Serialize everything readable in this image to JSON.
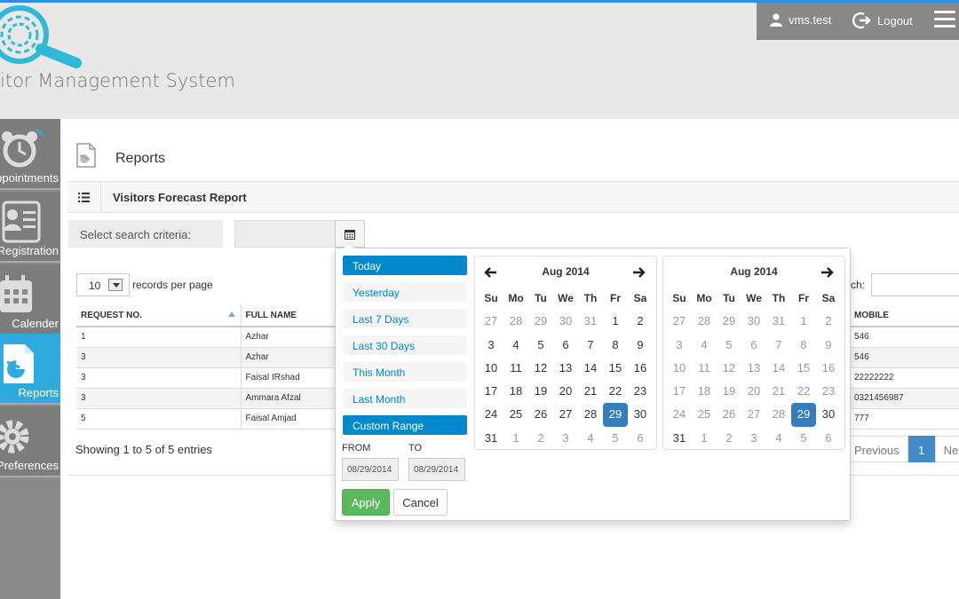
{
  "app": {
    "logo_text": "itor Management System",
    "user_name": "vms.test",
    "logout_label": "Logout"
  },
  "sidebar": {
    "items": [
      {
        "label": "Appointments",
        "icon": "alarm-clock-icon"
      },
      {
        "label": "Registration",
        "icon": "id-card-icon"
      },
      {
        "label": "Calender",
        "icon": "calendar-icon"
      },
      {
        "label": "Reports",
        "icon": "report-icon",
        "active": true
      },
      {
        "label": "Preferences",
        "icon": "gear-icon"
      }
    ]
  },
  "page": {
    "title": "Reports",
    "panel_title": "Visitors Forecast Report",
    "criteria_label": "Select search criteria:",
    "length_value": "10",
    "records_per_page": "records per page",
    "search_label": "rch:",
    "showing": "Showing 1 to 5 of 5 entries",
    "pager": {
      "previous": "Previous",
      "current": "1",
      "next": "Next"
    }
  },
  "table": {
    "headers": [
      "REQUEST NO.",
      "FULL NAME"
    ],
    "mobile_header": "MOBILE",
    "rows": [
      {
        "req": "1",
        "name": "Azhar",
        "mobile": "546"
      },
      {
        "req": "3",
        "name": "Azhar",
        "mobile": "546"
      },
      {
        "req": "3",
        "name": "Faisal IRshad",
        "mobile": "22222222"
      },
      {
        "req": "3",
        "name": "Ammara Afzal",
        "mobile": "0321456987"
      },
      {
        "req": "5",
        "name": "Faisal Amjad",
        "mobile": "777"
      }
    ]
  },
  "daterange": {
    "ranges": [
      {
        "label": "Today",
        "active": true
      },
      {
        "label": "Yesterday",
        "active": false
      },
      {
        "label": "Last 7 Days",
        "active": false
      },
      {
        "label": "Last 30 Days",
        "active": false
      },
      {
        "label": "This Month",
        "active": false
      },
      {
        "label": "Last Month",
        "active": false
      },
      {
        "label": "Custom Range",
        "active": true
      }
    ],
    "from_label": "FROM",
    "to_label": "TO",
    "from_value": "08/29/2014",
    "to_value": "08/29/2014",
    "apply_label": "Apply",
    "cancel_label": "Cancel",
    "weekdays": [
      "Su",
      "Mo",
      "Tu",
      "We",
      "Th",
      "Fr",
      "Sa"
    ],
    "calendars": [
      {
        "title": "Aug 2014",
        "selected": 29,
        "weeks": [
          [
            27,
            28,
            29,
            30,
            31,
            1,
            2
          ],
          [
            3,
            4,
            5,
            6,
            7,
            8,
            9
          ],
          [
            10,
            11,
            12,
            13,
            14,
            15,
            16
          ],
          [
            17,
            18,
            19,
            20,
            21,
            22,
            23
          ],
          [
            24,
            25,
            26,
            27,
            28,
            29,
            30
          ],
          [
            31,
            1,
            2,
            3,
            4,
            5,
            6
          ]
        ],
        "off": [
          [
            0,
            0
          ],
          [
            0,
            1
          ],
          [
            0,
            2
          ],
          [
            0,
            3
          ],
          [
            0,
            4
          ],
          [
            5,
            1
          ],
          [
            5,
            2
          ],
          [
            5,
            3
          ],
          [
            5,
            4
          ],
          [
            5,
            5
          ],
          [
            5,
            6
          ]
        ]
      },
      {
        "title": "Aug 2014",
        "selected": 29,
        "weeks": [
          [
            27,
            28,
            29,
            30,
            31,
            1,
            2
          ],
          [
            3,
            4,
            5,
            6,
            7,
            8,
            9
          ],
          [
            10,
            11,
            12,
            13,
            14,
            15,
            16
          ],
          [
            17,
            18,
            19,
            20,
            21,
            22,
            23
          ],
          [
            24,
            25,
            26,
            27,
            28,
            29,
            30
          ],
          [
            31,
            1,
            2,
            3,
            4,
            5,
            6
          ]
        ],
        "mode": "right"
      }
    ]
  },
  "colors": {
    "accent": "#2eaadc",
    "primary": "#0088cc",
    "selected_day": "#357ebd",
    "apply": "#5cb85c"
  }
}
